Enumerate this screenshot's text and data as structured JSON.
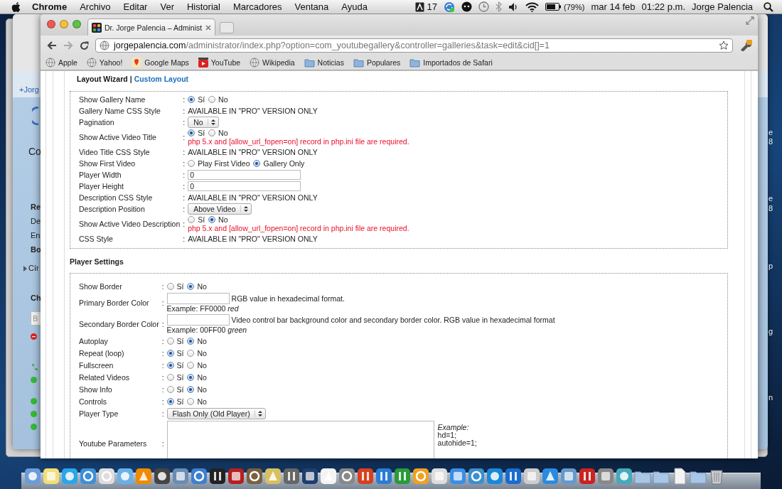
{
  "menubar": {
    "app": "Chrome",
    "menus": [
      "Archivo",
      "Editar",
      "Ver",
      "Historial",
      "Marcadores",
      "Ventana",
      "Ayuda"
    ],
    "badge_count": "17",
    "battery": "(79%)",
    "date": "mar 14 feb",
    "time": "01:22 p.m.",
    "user": "Jorge Palencia"
  },
  "background_window": {
    "fragments": [
      {
        "kind": "link",
        "text": "+Jorg"
      },
      {
        "kind": "title",
        "text": "Co"
      },
      {
        "kind": "bold",
        "text": "Re"
      },
      {
        "kind": "plain",
        "text": "De"
      },
      {
        "kind": "plain",
        "text": "En"
      },
      {
        "kind": "bold",
        "text": "Bo"
      },
      {
        "kind": "group",
        "text": "Cír"
      },
      {
        "kind": "bold",
        "text": "Ch"
      },
      {
        "kind": "field",
        "text": "B"
      }
    ]
  },
  "desktop_fragments": [
    "e",
    "8",
    "e",
    "8",
    "p",
    "g",
    "n"
  ],
  "browser": {
    "tab": {
      "title": "Dr. Jorge Palencia – Administ",
      "selected": true
    },
    "url": "**jorgepalencia.com**/administrator/index.php?option=com_youtubegallery&controller=galleries&task=edit&cid[]=1",
    "bookmarks": [
      {
        "label": "Apple",
        "kind": "site"
      },
      {
        "label": "Yahoo!",
        "kind": "site"
      },
      {
        "label": "Google Maps",
        "kind": "maps"
      },
      {
        "label": "YouTube",
        "kind": "video"
      },
      {
        "label": "Wikipedia",
        "kind": "site"
      },
      {
        "label": "Noticias",
        "kind": "folder"
      },
      {
        "label": "Populares",
        "kind": "folder"
      },
      {
        "label": "Importados de Safari",
        "kind": "folder"
      }
    ]
  },
  "layout_links": [
    {
      "label": "Layout Wizard",
      "selected": true
    },
    {
      "label": "Custom Layout",
      "selected": false
    }
  ],
  "layout_links_separator": "|",
  "layout_settings": [
    {
      "label": "Show Gallery Name",
      "sep": ":",
      "kind": "radio",
      "options": [
        {
          "label": "Sí",
          "selected": true
        },
        {
          "label": "No",
          "selected": false
        }
      ]
    },
    {
      "label": "Gallery Name CSS Style",
      "sep": ":",
      "kind": "text",
      "value": "AVAILABLE IN \"PRO\" VERSION ONLY"
    },
    {
      "label": "Pagination",
      "sep": ":",
      "kind": "select",
      "value": "No"
    },
    {
      "label": "Show Active Video Title",
      "sep": ":",
      "kind": "radio",
      "options": [
        {
          "label": "Sí",
          "selected": true
        },
        {
          "label": "No",
          "selected": false
        }
      ],
      "note": "php 5.x and [allow_url_fopen=on] record in php.ini file are required."
    },
    {
      "label": "Video Title CSS Style",
      "sep": ":",
      "kind": "text",
      "value": "AVAILABLE IN \"PRO\" VERSION ONLY"
    },
    {
      "label": "Show First Video",
      "sep": ":",
      "kind": "radio",
      "options": [
        {
          "label": "Play First Video",
          "selected": false
        },
        {
          "label": "Gallery Only",
          "selected": true
        }
      ]
    },
    {
      "label": "Player Width",
      "sep": ":",
      "kind": "input",
      "value": "0"
    },
    {
      "label": "Player Height",
      "sep": ":",
      "kind": "input",
      "value": "0"
    },
    {
      "label": "Description CSS Style",
      "sep": ":",
      "kind": "text",
      "value": "AVAILABLE IN \"PRO\" VERSION ONLY"
    },
    {
      "label": "Description Position",
      "sep": ":",
      "kind": "select",
      "value": "Above Video"
    },
    {
      "label": "Show Active Video Description",
      "sep": ":",
      "kind": "radio",
      "options": [
        {
          "label": "Sí",
          "selected": false
        },
        {
          "label": "No",
          "selected": true
        }
      ],
      "note": "php 5.x and [allow_url_fopen=on] record in php.ini file are required."
    },
    {
      "label": "CSS Style",
      "sep": ":",
      "kind": "text",
      "value": "AVAILABLE IN \"PRO\" VERSION ONLY"
    }
  ],
  "player_settings": {
    "heading": "Player Settings",
    "rows": [
      {
        "label": "Show Border",
        "sep": ":",
        "kind": "radio",
        "options": [
          {
            "label": "Sí",
            "selected": false
          },
          {
            "label": "No",
            "selected": true
          }
        ]
      },
      {
        "label": "Primary Border Color",
        "sep": ":",
        "kind": "color",
        "hint": "RGB value in hexadecimal format.",
        "example": "Example: FF0000 *red*"
      },
      {
        "label": "Secondary Border Color",
        "sep": ":",
        "kind": "color",
        "hint": "Video control bar background color and secondary border color. RGB value in hexadecimal format",
        "example": "Example: 00FF00 *green*"
      },
      {
        "label": "Autoplay",
        "sep": ":",
        "kind": "radio",
        "options": [
          {
            "label": "Sí",
            "selected": false
          },
          {
            "label": "No",
            "selected": true
          }
        ]
      },
      {
        "label": "Repeat (loop)",
        "sep": ":",
        "kind": "radio",
        "options": [
          {
            "label": "Sí",
            "selected": true
          },
          {
            "label": "No",
            "selected": false
          }
        ]
      },
      {
        "label": "Fullscreen",
        "sep": ":",
        "kind": "radio",
        "options": [
          {
            "label": "Sí",
            "selected": true
          },
          {
            "label": "No",
            "selected": false
          }
        ]
      },
      {
        "label": "Related Videos",
        "sep": ":",
        "kind": "radio",
        "options": [
          {
            "label": "Sí",
            "selected": false
          },
          {
            "label": "No",
            "selected": true
          }
        ]
      },
      {
        "label": "Show Info",
        "sep": ":",
        "kind": "radio",
        "options": [
          {
            "label": "Sí",
            "selected": false
          },
          {
            "label": "No",
            "selected": true
          }
        ]
      },
      {
        "label": "Controls",
        "sep": ":",
        "kind": "radio",
        "options": [
          {
            "label": "Sí",
            "selected": true
          },
          {
            "label": "No",
            "selected": false
          }
        ]
      },
      {
        "label": "Player Type",
        "sep": ":",
        "kind": "select",
        "value": "Flash Only (Old Player)"
      },
      {
        "label": "Youtube Parameters",
        "sep": ":",
        "kind": "textarea",
        "example_title": "Example:",
        "example_lines": [
          "hd=1;",
          "autohide=1;"
        ]
      }
    ]
  }
}
